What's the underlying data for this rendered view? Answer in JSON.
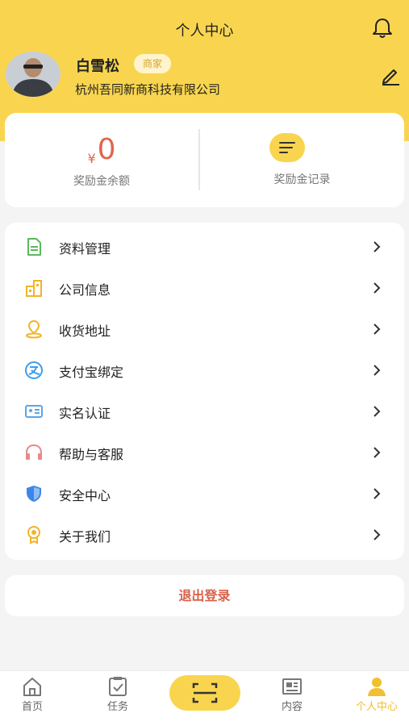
{
  "header": {
    "title": "个人中心",
    "user_name": "白雪松",
    "role_badge": "商家",
    "company": "杭州吾同新商科技有限公司"
  },
  "wallet": {
    "currency_symbol": "¥",
    "balance": "0",
    "balance_label": "奖励金余额",
    "record_label": "奖励金记录"
  },
  "menu": [
    {
      "label": "资料管理",
      "icon": "document-icon",
      "color": "#5cb85c"
    },
    {
      "label": "公司信息",
      "icon": "building-icon",
      "color": "#f0b429"
    },
    {
      "label": "收货地址",
      "icon": "location-pin-icon",
      "color": "#f0b429"
    },
    {
      "label": "支付宝绑定",
      "icon": "alipay-icon",
      "color": "#3b9cf0"
    },
    {
      "label": "实名认证",
      "icon": "id-card-icon",
      "color": "#5aa6e6"
    },
    {
      "label": "帮助与客服",
      "icon": "headset-icon",
      "color": "#e98a8a"
    },
    {
      "label": "安全中心",
      "icon": "shield-icon",
      "color": "#3b86e6"
    },
    {
      "label": "关于我们",
      "icon": "medal-icon",
      "color": "#f0b429"
    }
  ],
  "logout_label": "退出登录",
  "tabbar": {
    "tabs": [
      {
        "label": "首页",
        "icon": "home-icon"
      },
      {
        "label": "任务",
        "icon": "clipboard-check-icon"
      },
      {
        "label": "内容",
        "icon": "news-icon"
      },
      {
        "label": "个人中心",
        "icon": "person-icon"
      }
    ],
    "scan_icon": "scan-icon",
    "active_tab": "个人中心"
  },
  "colors": {
    "brand_yellow": "#f9d54f",
    "accent_red": "#e0664d",
    "background": "#f4f4f4"
  }
}
